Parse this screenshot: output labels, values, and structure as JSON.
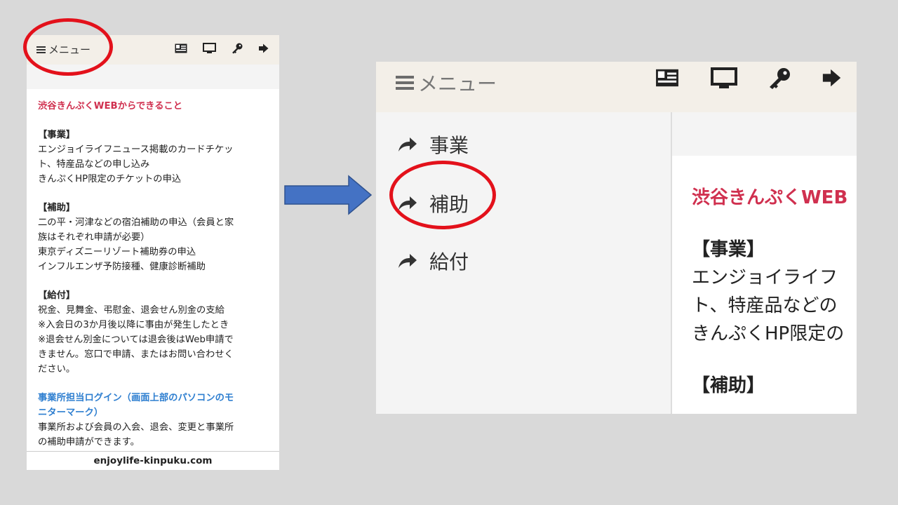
{
  "phone": {
    "menu_label": "メニュー",
    "heading": "渋谷きんぷくWEBからできること",
    "sections": [
      {
        "title": "【事業】",
        "lines": [
          "エンジョイライフニュース掲載のカードチケッ",
          "ト、特産品などの申し込み",
          "きんぷくHP限定のチケットの申込"
        ]
      },
      {
        "title": "【補助】",
        "lines": [
          "二の平・河津などの宿泊補助の申込（会員と家",
          "族はそれぞれ申請が必要）",
          "東京ディズニーリゾート補助券の申込",
          "インフルエンザ予防接種、健康診断補助"
        ]
      },
      {
        "title": "【給付】",
        "lines": [
          "祝金、見舞金、弔慰金、退会せん別金の支給",
          "※入会日の3か月後以降に事由が発生したとき",
          "※退会せん別金については退会後はWeb申請で",
          "きません。窓口で申請、またはお問い合わせく",
          "ださい。"
        ]
      }
    ],
    "office_link_line1": "事業所担当ログイン（画面上部のパソコンのモ",
    "office_link_line2": "ニターマーク）",
    "office_desc_line1": "事業所および会員の入会、退会、変更と事業所",
    "office_desc_line2": "の補助申請ができます。",
    "footer_url": "enjoylife-kinpuku.com"
  },
  "zoom": {
    "menu_label": "メニュー",
    "side_items": [
      {
        "label": "事業",
        "icon": "share-arrow-icon"
      },
      {
        "label": "補助",
        "icon": "share-arrow-icon"
      },
      {
        "label": "給付",
        "icon": "share-arrow-icon"
      }
    ],
    "heading": "渋谷きんぷくWEB",
    "section1_title": "【事業】",
    "section1_lines": [
      "エンジョイライフ",
      "ト、特産品などの",
      "きんぷくHP限定の"
    ],
    "section2_title": "【補助】"
  },
  "icons": [
    "id-card-icon",
    "monitor-icon",
    "key-icon",
    "logout-icon"
  ],
  "colors": {
    "accent_pink": "#d0304f",
    "link_blue": "#2f7fd0",
    "highlight_red": "#e3111b",
    "arrow_blue": "#4472c4",
    "header_beige": "#f3efe8"
  }
}
